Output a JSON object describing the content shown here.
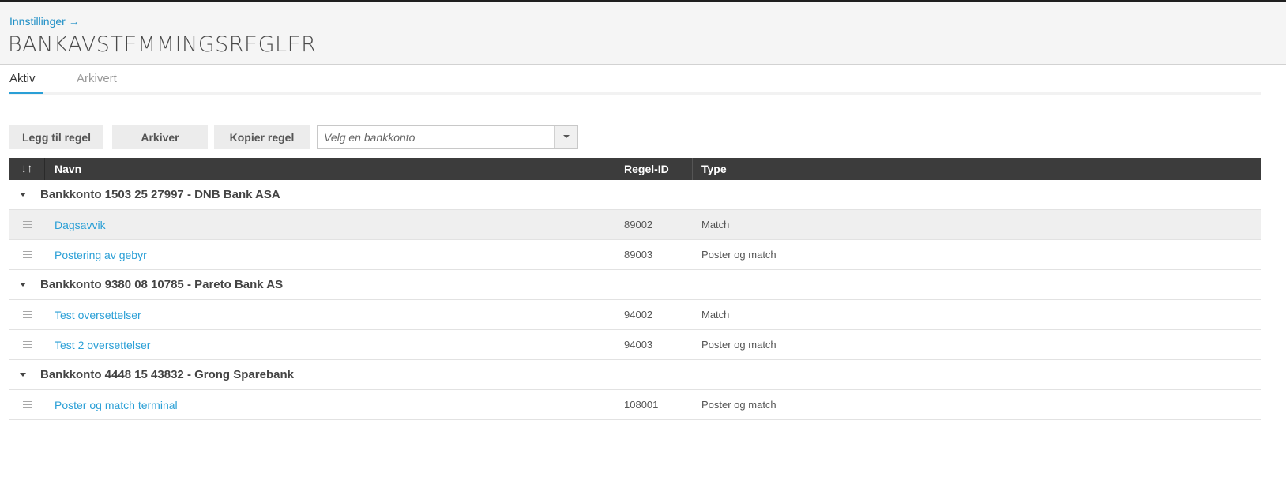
{
  "header": {
    "breadcrumb": "Innstillinger →",
    "title": "BANKAVSTEMMINGSREGLER"
  },
  "tabs": [
    {
      "label": "Aktiv",
      "active": true
    },
    {
      "label": "Arkivert",
      "active": false
    }
  ],
  "toolbar": {
    "add_label": "Legg til regel",
    "archive_label": "Arkiver",
    "copy_label": "Kopier regel",
    "account_placeholder": "Velg en bankkonto"
  },
  "table": {
    "sort_icon": "↓↑",
    "columns": {
      "name": "Navn",
      "rule_id": "Regel-ID",
      "type": "Type"
    },
    "groups": [
      {
        "label": "Bankkonto 1503 25 27997 - DNB Bank ASA",
        "rows": [
          {
            "name": "Dagsavvik",
            "rule_id": "89002",
            "type": "Match"
          },
          {
            "name": "Postering av gebyr",
            "rule_id": "89003",
            "type": "Poster og match"
          }
        ]
      },
      {
        "label": "Bankkonto 9380 08 10785 - Pareto Bank AS",
        "rows": [
          {
            "name": "Test oversettelser",
            "rule_id": "94002",
            "type": "Match"
          },
          {
            "name": "Test 2 oversettelser",
            "rule_id": "94003",
            "type": "Poster og match"
          }
        ]
      },
      {
        "label": "Bankkonto 4448 15 43832 - Grong Sparebank",
        "rows": [
          {
            "name": "Poster og match terminal",
            "rule_id": "108001",
            "type": "Poster og match"
          }
        ]
      }
    ]
  },
  "colors": {
    "accent": "#2a9fd6",
    "header_bg": "#3c3c3c",
    "hover_row": "#efefef"
  }
}
